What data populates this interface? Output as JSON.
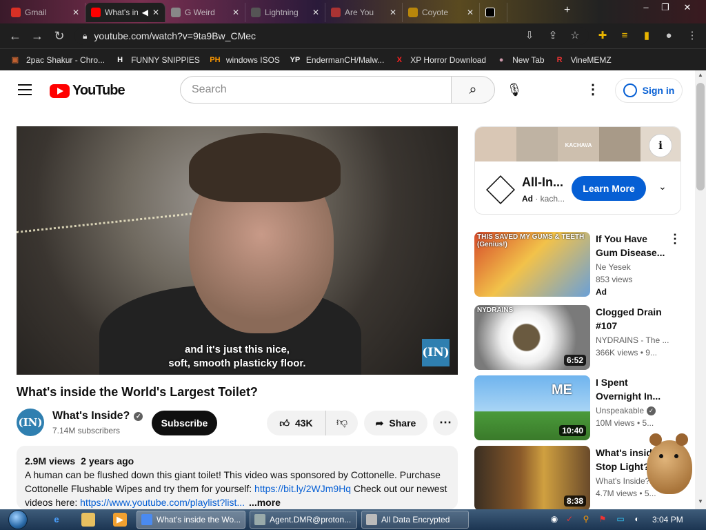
{
  "browser": {
    "tabs": [
      {
        "label": "Gmail",
        "fav": "#d93025"
      },
      {
        "label": "What's inside the World's Largest Toilet?",
        "fav": "#ff0000",
        "active": true
      },
      {
        "label": "G Weird",
        "fav": "#888"
      },
      {
        "label": "Lightning",
        "fav": "#555"
      },
      {
        "label": "Are You",
        "fav": "#a33"
      },
      {
        "label": "Coyote",
        "fav": "#b8860b"
      },
      {
        "label": "",
        "fav": "#000"
      }
    ],
    "url": "youtube.com/watch?v=9ta9Bw_CMec",
    "bookmarks": [
      {
        "label": "2pac Shakur - Chro...",
        "icon": "chrome-profile-icon",
        "glyph": "▣",
        "color": "#c06030"
      },
      {
        "label": "FUNNY SNIPPIES",
        "icon": "h-icon",
        "glyph": "H",
        "color": "#fff"
      },
      {
        "label": "windows ISOS",
        "icon": "ph-icon",
        "glyph": "PH",
        "color": "#f90"
      },
      {
        "label": "EndermanCH/Malw...",
        "icon": "yp-icon",
        "glyph": "YP",
        "color": "#eee"
      },
      {
        "label": "XP Horror Download",
        "icon": "x-icon",
        "glyph": "X",
        "color": "#f22"
      },
      {
        "label": "New Tab",
        "icon": "globe-icon",
        "glyph": "●",
        "color": "#c9a"
      },
      {
        "label": "VineMEMZ",
        "icon": "r-icon",
        "glyph": "R",
        "color": "#e33"
      }
    ]
  },
  "yt": {
    "logo_text": "YouTube",
    "search_placeholder": "Search",
    "sign_in": "Sign in"
  },
  "video": {
    "caption_line1": "and it's just this nice,",
    "caption_line2": "soft, smooth plasticky floor.",
    "watermark": "(IN)",
    "title": "What's inside the World's Largest Toilet?",
    "channel": "What's Inside?",
    "channel_avatar": "(IN)",
    "subscribers": "7.14M subscribers",
    "subscribe": "Subscribe",
    "likes": "43K",
    "share": "Share",
    "views": "2.9M views",
    "age": "2 years ago",
    "desc_part1": "A human can be flushed down this giant toilet! This video was sponsored by Cottonelle. Purchase Cottonelle Flushable Wipes and try them for yourself: ",
    "desc_link1": "https://bit.ly/2WJm9Hq",
    "desc_part2": " Check out our newest videos here: ",
    "desc_link2": "https://www.youtube.com/playlist?list...",
    "desc_more": "...more"
  },
  "ad": {
    "title": "All-In...",
    "ad_label": "Ad",
    "advertiser": "kach...",
    "cta": "Learn More",
    "strip_brand": "KACHAVA"
  },
  "recommendations": [
    {
      "title": "If You Have Gum Disease...",
      "channel": "Ne Yesek",
      "views": "853 views",
      "ad": "Ad",
      "duration": "",
      "thumb_text": "THIS SAVED MY GUMS & TEETH (Genius!)",
      "thumb_bg": "linear-gradient(135deg,#d64a2a,#f2c24a 45%,#6aa0d8)",
      "verified": false
    },
    {
      "title": "Clogged Drain #107",
      "channel": "NYDRAINS - The ...",
      "views": "366K views • 9...",
      "ad": "",
      "duration": "6:52",
      "thumb_text": "NYDRAINS",
      "thumb_bg": "radial-gradient(circle at 45% 50%,#6a5a40 18%,#fff 20%,#eee 36%,#7a7a7a 70%)",
      "verified": false
    },
    {
      "title": "I Spent Overnight In...",
      "channel": "Unspeakable",
      "views": "10M views • 5...",
      "ad": "",
      "duration": "10:40",
      "thumb_text": "ME",
      "thumb_bg": "linear-gradient(#6fb4ee 0%,#a8d4f5 55%,#4a9a3a 56%,#3a7a2a)",
      "verified": true
    },
    {
      "title": "What's inside Stop Light?",
      "channel": "What's Inside?",
      "views": "4.7M views • 5...",
      "ad": "",
      "duration": "8:38",
      "thumb_text": "",
      "thumb_bg": "linear-gradient(90deg,#3a2e22,#8a5a2a 40%,#d0a040 60%,#6a4a2a)",
      "verified": true
    }
  ],
  "taskbar": {
    "tasks": [
      {
        "label": "What's inside the Wo...",
        "color": "#4a8af0",
        "active": true
      },
      {
        "label": "Agent.DMR@proton...",
        "color": "#9aa",
        "active": false
      },
      {
        "label": "All Data Encrypted",
        "color": "#bbb",
        "active": false
      }
    ],
    "time": "3:04 PM"
  },
  "colors": {
    "accent": "#065fd4",
    "youtube_red": "#ff0000"
  }
}
